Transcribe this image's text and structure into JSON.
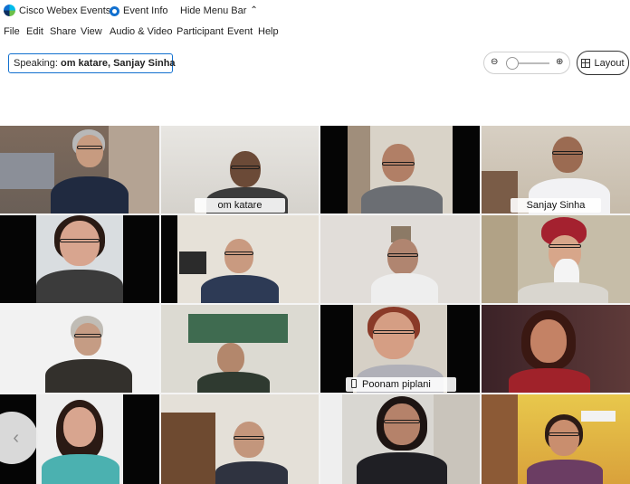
{
  "titlebar": {
    "app_title": "Cisco Webex Events",
    "event_info": "Event Info",
    "hide_menu": "Hide Menu Bar",
    "hide_menu_icon": "chevron-up-icon"
  },
  "menu": [
    "File",
    "Edit",
    "Share",
    "View",
    "Audio & Video",
    "Participant",
    "Event",
    "Help"
  ],
  "speaking": {
    "prefix": "Speaking:",
    "names": "om katare, Sanjay Sinha"
  },
  "zoom": {
    "out_icon": "zoom-out-icon",
    "in_icon": "zoom-in-icon",
    "level": 0
  },
  "layout_button": {
    "label": "Layout",
    "icon": "grid-layout-icon"
  },
  "participants": {
    "p2": "om katare",
    "p4": "Sanjay Sinha",
    "p11": "Poonam piplani"
  },
  "colors": {
    "accent": "#1170cf",
    "active_speaker_border": "#4ec4e8"
  }
}
